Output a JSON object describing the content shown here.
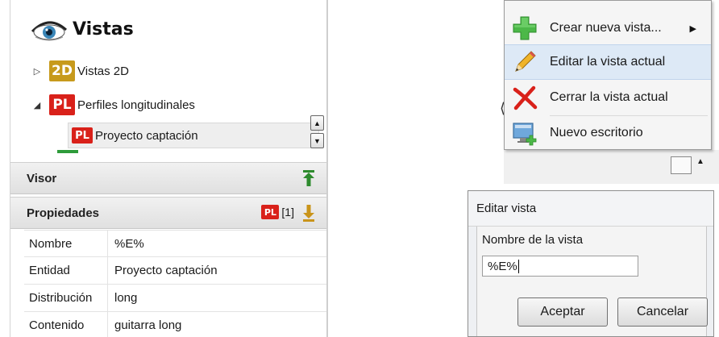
{
  "views_panel": {
    "title": "Vistas",
    "tree": [
      {
        "expander": "▷",
        "badge": "2D",
        "label": "Vistas 2D"
      },
      {
        "expander": "◢",
        "badge": "PL",
        "label": "Perfiles longitudinales"
      },
      {
        "badge": "PL",
        "label": "Proyecto captación"
      }
    ],
    "pager": "▲○○○▼"
  },
  "visor_section": {
    "title": "Visor"
  },
  "properties_section": {
    "title": "Propiedades",
    "badge": "PL",
    "count": "[1]"
  },
  "properties": [
    {
      "key": "Nombre",
      "value": "%E%"
    },
    {
      "key": "Entidad",
      "value": "Proyecto captación"
    },
    {
      "key": "Distribución",
      "value": "long"
    },
    {
      "key": "Contenido",
      "value": "guitarra long"
    }
  ],
  "context_menu": {
    "items": [
      {
        "label": "Crear nueva vista...",
        "icon": "green-plus-icon",
        "has_submenu": true,
        "submenu_arrow": "▶"
      },
      {
        "label": "Editar la vista actual",
        "icon": "pencil-icon"
      },
      {
        "label": "Cerrar la vista actual",
        "icon": "red-x-icon"
      },
      {
        "label": "Nuevo escritorio",
        "icon": "new-desktop-icon"
      }
    ]
  },
  "dialog": {
    "title": "Editar vista",
    "field_label": "Nombre de la vista",
    "field_value": "%E%",
    "accept": "Aceptar",
    "cancel": "Cancelar"
  },
  "colors": {
    "badge_2d": "#c79a1c",
    "badge_pl": "#d9211a",
    "menu_hover": "#dde9f6",
    "visor_arrow": "#2e8b2e",
    "prop_arrow": "#c9941a"
  }
}
